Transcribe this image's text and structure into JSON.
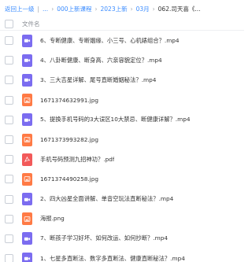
{
  "breadcrumb": {
    "items": [
      "返回上一级",
      "...",
      "000上新课程",
      "2023上新",
      "03月",
      "062.司天喜《..."
    ],
    "separator": "|"
  },
  "table": {
    "column_name": "文件名"
  },
  "files": [
    {
      "name": "6、专断健康、专断姻缘、小三号、心机婊组合？.mp4",
      "type": "video",
      "icon": "video-file-icon"
    },
    {
      "name": "4、八卦断健康、断身高、六亲容貌定位？.mp4",
      "type": "video",
      "icon": "video-file-icon"
    },
    {
      "name": "3、三大吉星详解、尾号直断婚姻秘法？.mp4",
      "type": "video",
      "icon": "video-file-icon"
    },
    {
      "name": "1671374632991.jpg",
      "type": "image",
      "icon": "image-file-icon"
    },
    {
      "name": "5、提换手机号码的3大误区10大禁忌、断健康详解？.mp4",
      "type": "video",
      "icon": "video-file-icon"
    },
    {
      "name": "1671373993282.jpg",
      "type": "image",
      "icon": "image-file-icon"
    },
    {
      "name": "手机号码预测九招神功？.pdf",
      "type": "pdf",
      "icon": "pdf-file-icon"
    },
    {
      "name": "1671374490258.jpg",
      "type": "image",
      "icon": "image-file-icon"
    },
    {
      "name": "2、四大凶星全面讲解、单音空玩法直断秘法？.mp4",
      "type": "video",
      "icon": "video-file-icon"
    },
    {
      "name": "海报.png",
      "type": "image",
      "icon": "image-file-icon"
    },
    {
      "name": "7、断孩子学习好坏、如何改运、如何抄断？.mp4",
      "type": "video",
      "icon": "video-file-icon"
    },
    {
      "name": "1、七星多直断法、数字多直断法、健康直断秘法？.mp4",
      "type": "video",
      "icon": "video-file-icon"
    }
  ],
  "colors": {
    "link": "#3b8cff",
    "video_icon": "#7b6cf0",
    "image_icon": "#ff7a45",
    "pdf_icon": "#f25a5a"
  }
}
